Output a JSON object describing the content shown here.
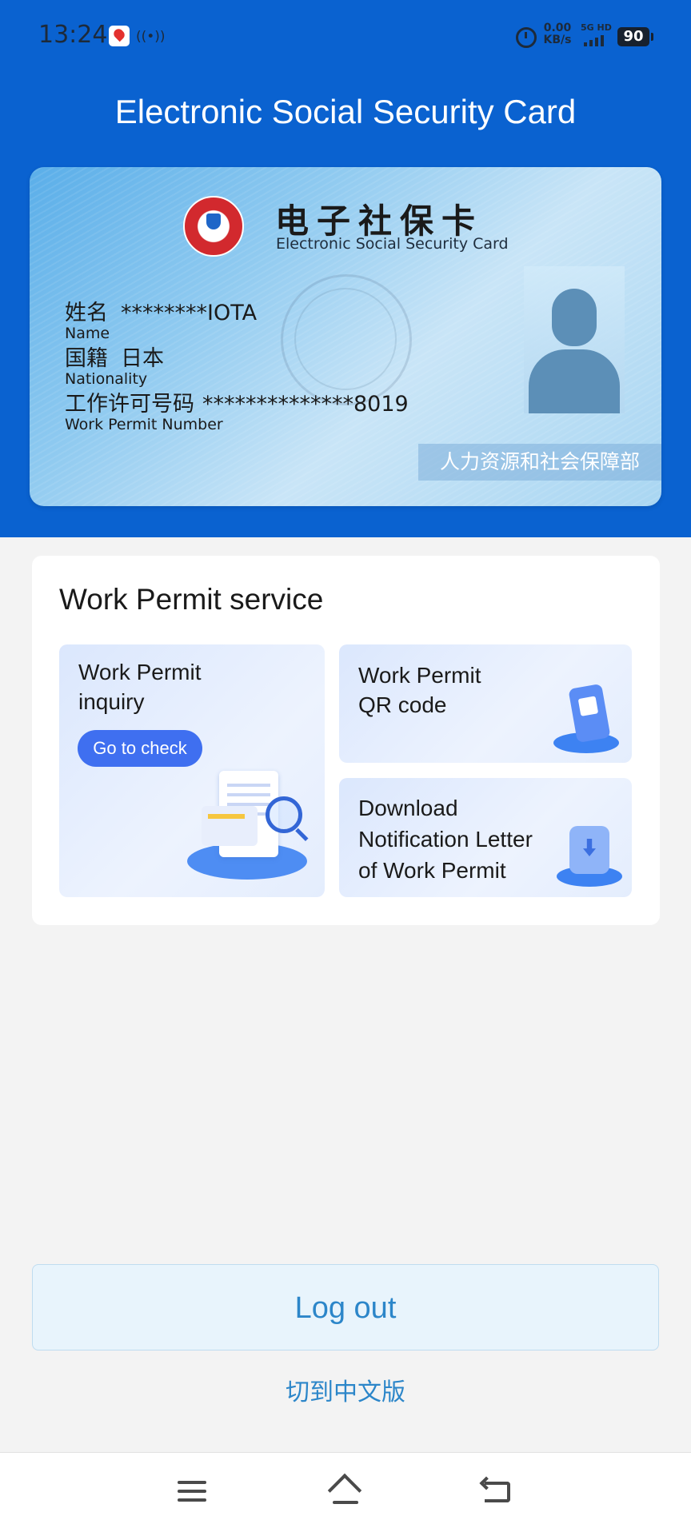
{
  "status_bar": {
    "time": "13:24",
    "net_speed_value": "0.00",
    "net_speed_unit": "KB/s",
    "network_label": "5G HD",
    "battery": "90"
  },
  "header": {
    "title": "Electronic Social Security Card"
  },
  "card": {
    "title_cn": "电子社保卡",
    "title_en": "Electronic Social Security Card",
    "name_label_cn": "姓名",
    "name_label_en": "Name",
    "name_value": "********IOTA",
    "nationality_label_cn": "国籍",
    "nationality_label_en": "Nationality",
    "nationality_value": "日本",
    "permit_label_cn": "工作许可号码",
    "permit_label_en": "Work Permit Number",
    "permit_value": "**************8019",
    "issuer": "人力资源和社会保障部"
  },
  "service": {
    "title": "Work Permit service",
    "tiles": [
      {
        "line1": "Work Permit",
        "line2": "inquiry",
        "button": "Go to check"
      },
      {
        "line1": "Work Permit",
        "line2": "QR code"
      },
      {
        "line1": "Download",
        "line2": "Notification Letter",
        "line3": "of Work Permit"
      }
    ]
  },
  "actions": {
    "logout": "Log out",
    "switch_language": "切到中文版"
  },
  "icons": [
    "notification-icon",
    "hotspot-icon",
    "alarm-icon",
    "signal-icon",
    "menu-icon",
    "home-icon",
    "back-icon"
  ],
  "colors": {
    "header_blue": "#0a62d0",
    "accent_button": "#3f6ff0",
    "link_blue": "#2c86c9"
  }
}
